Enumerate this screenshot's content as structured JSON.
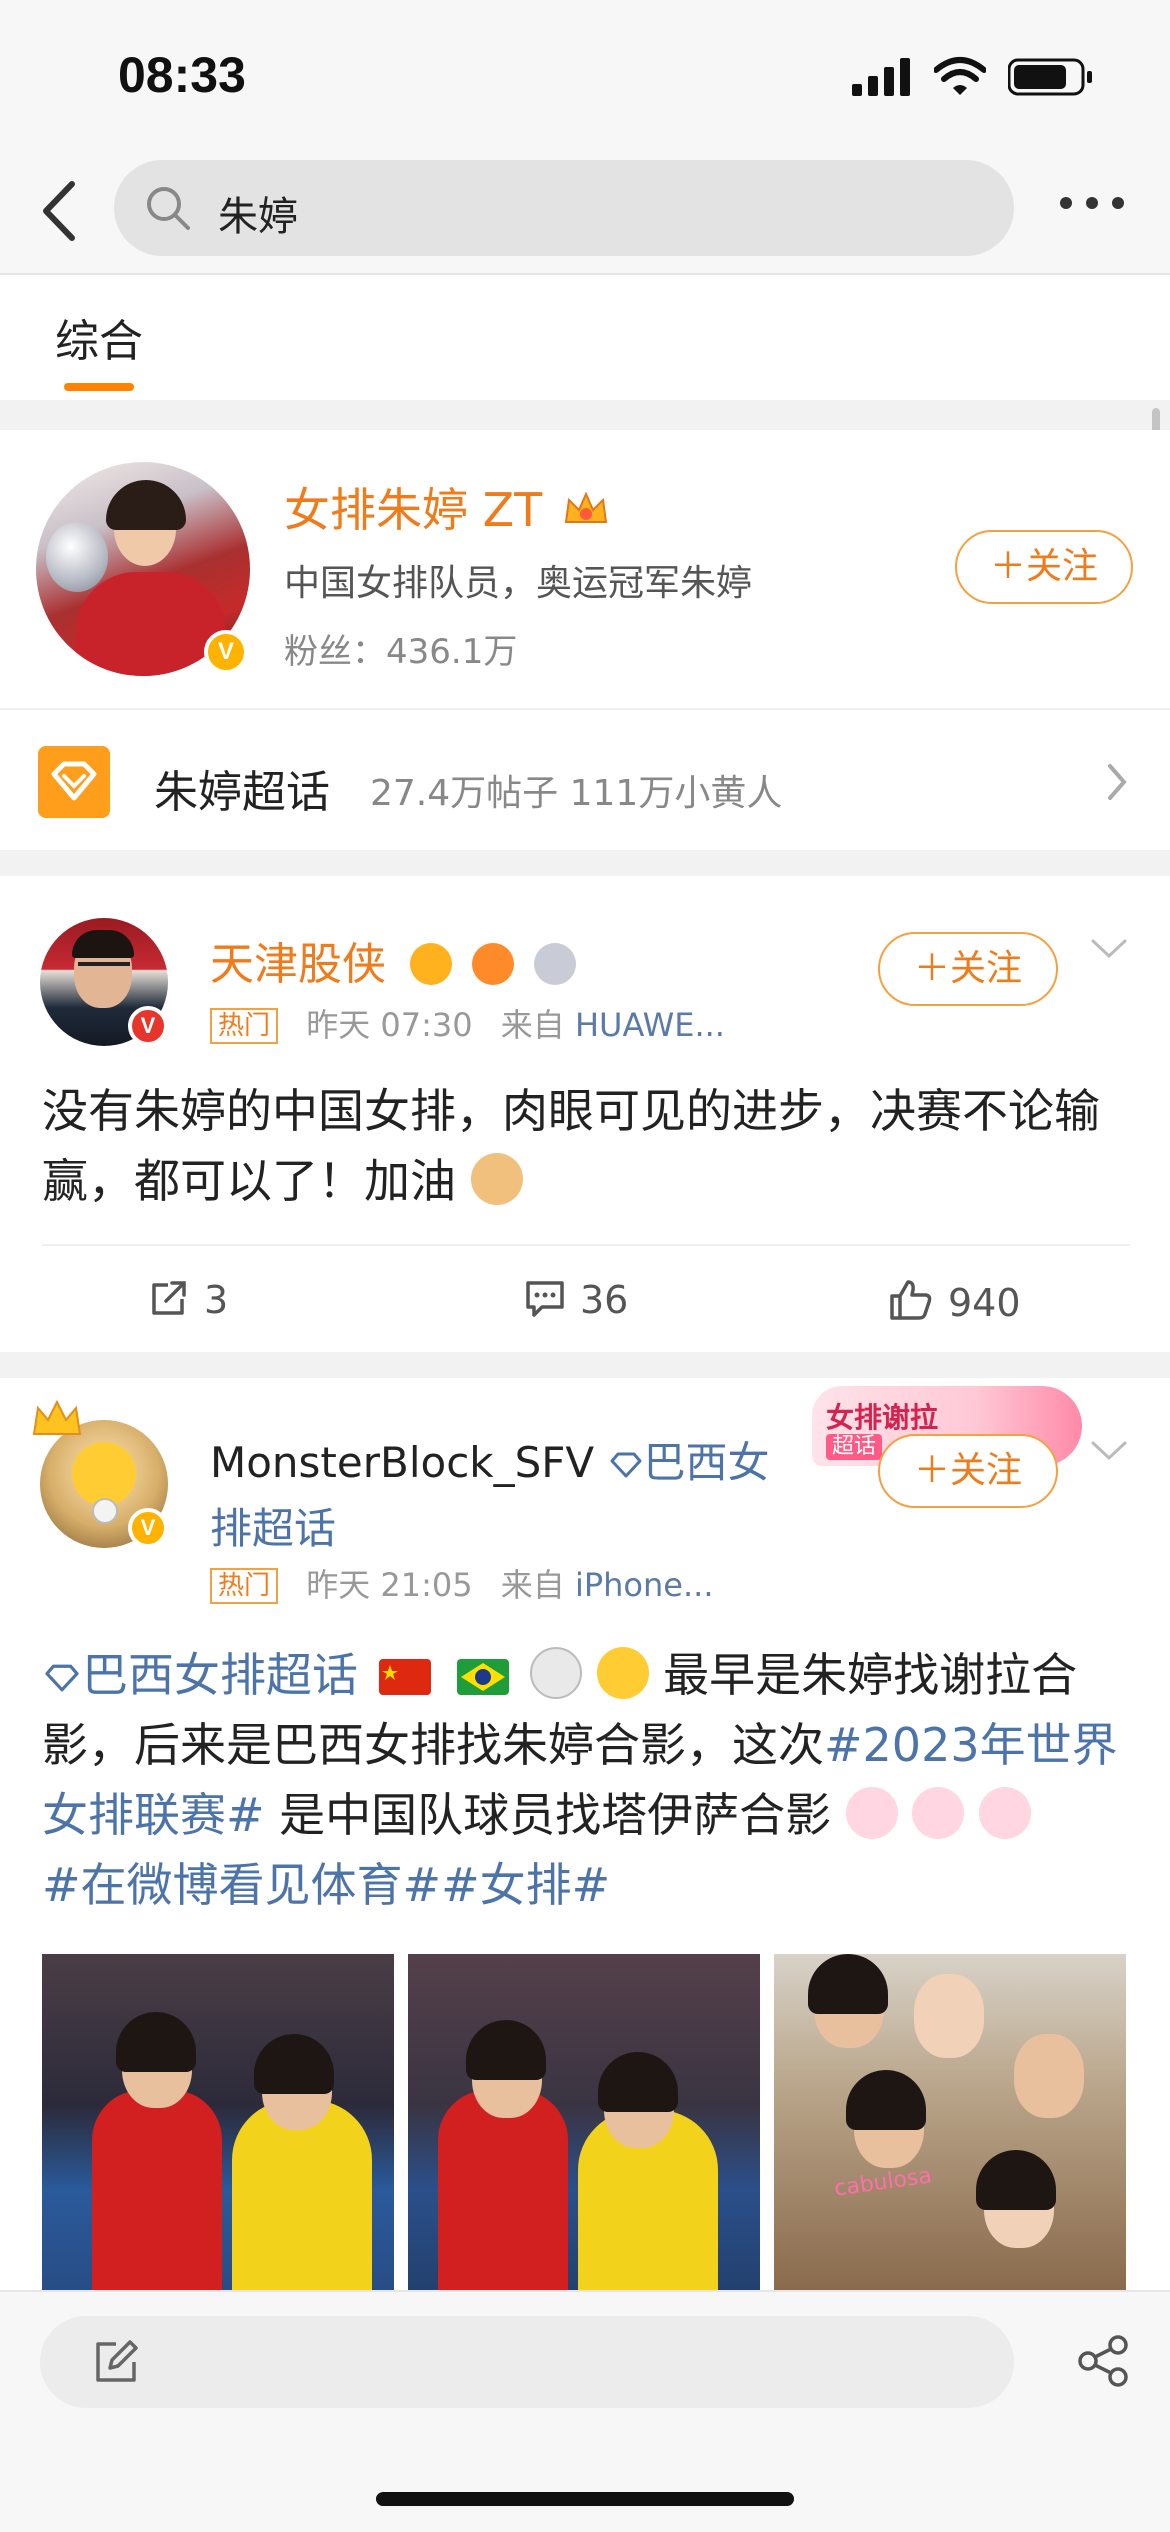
{
  "status_bar": {
    "time": "08:33"
  },
  "search": {
    "query": "朱婷",
    "back_icon": "chevron-left-icon",
    "more_icon": "more-dots-icon"
  },
  "tabs": [
    {
      "label": "综合",
      "active": true
    }
  ],
  "profile": {
    "name": "女排朱婷 ZT",
    "description": "中国女排队员，奥运冠军朱婷",
    "fans": "粉丝：436.1万",
    "follow_label": "＋关注",
    "verified_badge": "V"
  },
  "supertopic": {
    "name": "朱婷超话",
    "stats": "27.4万帖子  111万小黄人"
  },
  "posts": [
    {
      "author": "天津股侠",
      "hot_tag": "热门",
      "time": "昨天 07:30",
      "source_prefix": "来自",
      "source": "HUAWE...",
      "follow_label": "＋关注",
      "text": "没有朱婷的中国女排，肉眼可见的进步，决赛不论输赢，都可以了！加油",
      "reposts": "3",
      "comments": "36",
      "likes": "940"
    },
    {
      "author": "MonsterBlock_SFV",
      "author_topic": "巴西女排超话",
      "promo_title": "女排谢拉",
      "promo_sub": "超话",
      "hot_tag": "热门",
      "time": "昨天 21:05",
      "source_prefix": "来自",
      "source": "iPhone...",
      "follow_label": "＋关注",
      "text_topic": "巴西女排超话",
      "text_mid": "最早是朱婷找谢拉合影，后来是巴西女排找朱婷合影，这次",
      "text_hashtag1": "#2023年世界女排联赛#",
      "text_after": "是中国队球员找塔伊萨合影",
      "text_hashtag2": "#在微博看见体育##女排#",
      "photo_caption": "cabulosa"
    }
  ],
  "colors": {
    "accent": "#f07b1b",
    "link": "#4d74a8",
    "hot": "#f5a041"
  }
}
